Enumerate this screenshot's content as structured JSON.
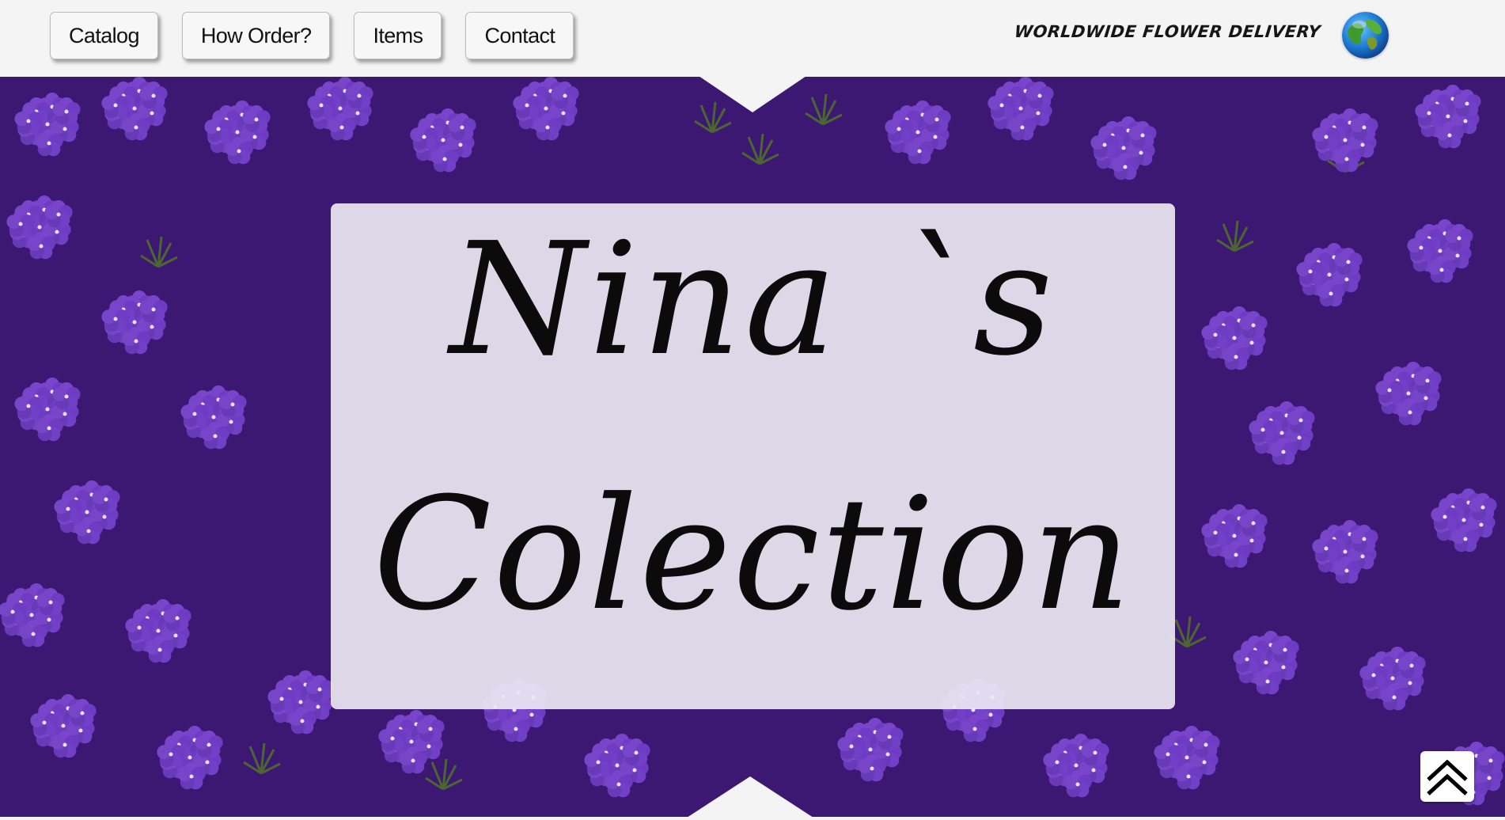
{
  "nav": {
    "items": [
      {
        "label": "Catalog"
      },
      {
        "label": "How Order?"
      },
      {
        "label": "Items"
      },
      {
        "label": "Contact"
      }
    ]
  },
  "header": {
    "tagline": "WORLDWIDE FLOWER DELIVERY",
    "globe_icon": "globe-icon"
  },
  "hero": {
    "title_line1": "Nina `s",
    "title_line2": "Colection",
    "background": "purple-verbena-flowers"
  },
  "scroll_top": {
    "icon": "double-chevron-up-icon"
  },
  "colors": {
    "page_bg": "#f4f4f4",
    "flower_purple": "#5a28a2",
    "card_bg": "#ece8f2",
    "text": "#0b0b0b"
  }
}
